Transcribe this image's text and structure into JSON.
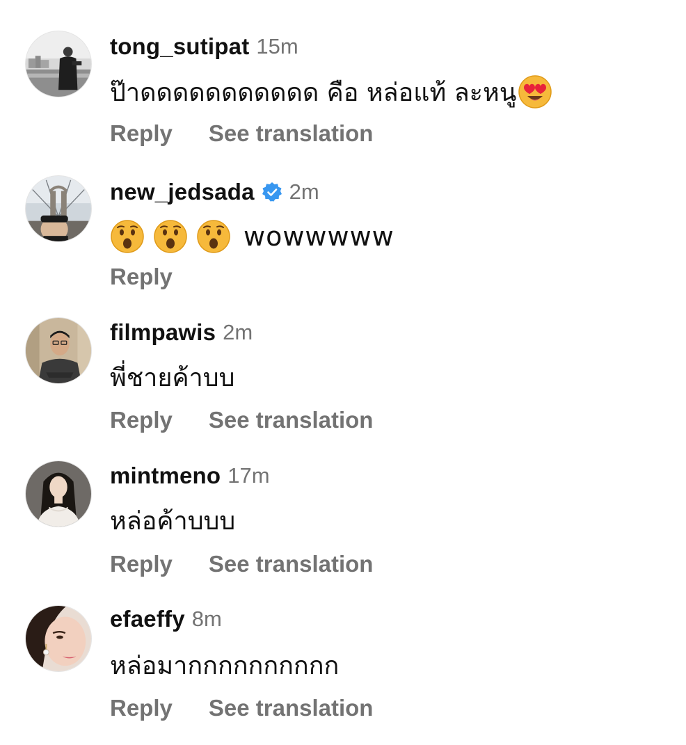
{
  "comments": [
    {
      "username": "tong_sutipat",
      "time": "15m",
      "text": "ป๊าดดดดดดดดดดด คือ หล่อแท้ ละหนู",
      "emoji": "heart-eyes-emoji",
      "verified": false,
      "actions": [
        "Reply",
        "See translation"
      ]
    },
    {
      "username": "new_jedsada",
      "time": "2m",
      "text": "wowwwww",
      "emoji": "astonished-face-emoji",
      "verified": true,
      "actions": [
        "Reply"
      ]
    },
    {
      "username": "filmpawis",
      "time": "2m",
      "text": "พี่ชายค้าบบ",
      "verified": false,
      "actions": [
        "Reply",
        "See translation"
      ]
    },
    {
      "username": "mintmeno",
      "time": "17m",
      "text": "หล่อค้าบบบ",
      "verified": false,
      "actions": [
        "Reply",
        "See translation"
      ]
    },
    {
      "username": "efaeffy",
      "time": "8m",
      "text": "หล่อมากกกกกกกกกก",
      "verified": false,
      "actions": [
        "Reply",
        "See translation"
      ]
    }
  ],
  "colors": {
    "username": "#111111",
    "secondary": "#737373",
    "verified_badge": "#3897f0",
    "background": "#ffffff"
  }
}
